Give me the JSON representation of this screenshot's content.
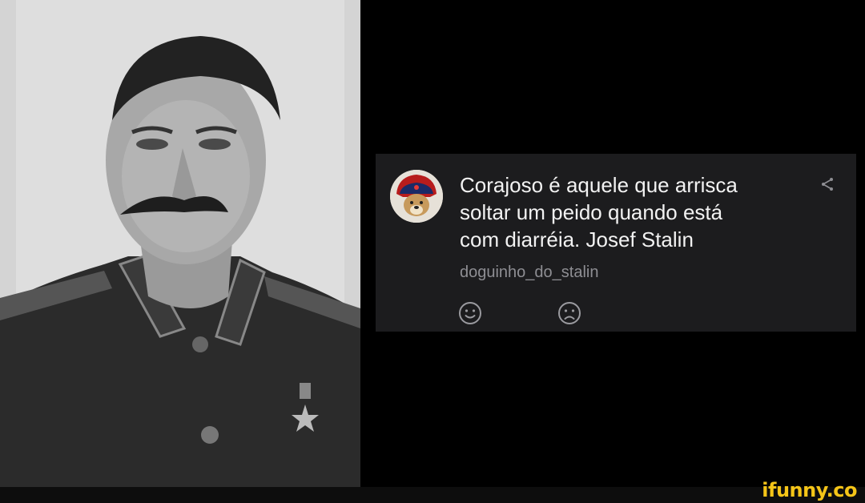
{
  "comment": {
    "text": "Corajoso é aquele que arrisca\nsoltar um peido quando está\ncom diarréia. Josef Stalin",
    "username": "doguinho_do_stalin",
    "avatar_icon": "dog-in-ushanka-avatar",
    "share_icon": "share-icon",
    "reactions": [
      {
        "icon": "smile-icon"
      },
      {
        "icon": "frown-icon"
      }
    ]
  },
  "watermark": {
    "text": "ifunny.co",
    "color": "#f5c518"
  },
  "colors": {
    "background": "#000000",
    "card": "#1c1c1e",
    "comment_text": "#f2f2f2",
    "username": "#8e8e93"
  }
}
